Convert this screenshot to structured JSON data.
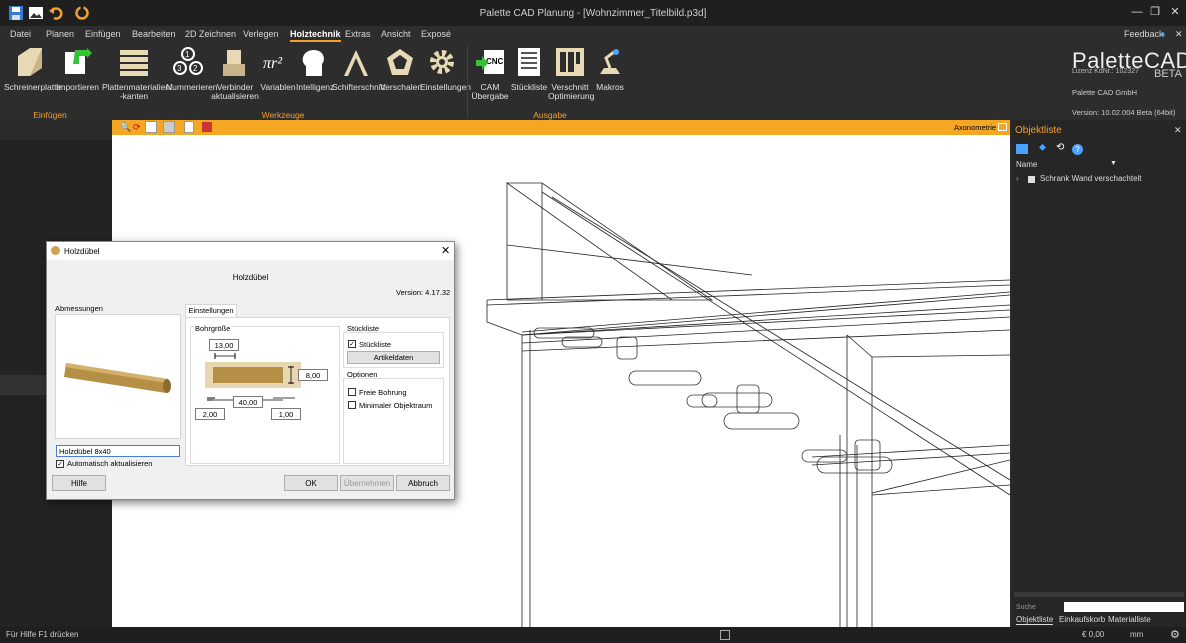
{
  "window": {
    "title": "Palette CAD Planung - [Wohnzimmer_Titelbild.p3d]",
    "feedback": "Feedback"
  },
  "menu_tabs": [
    "Datei",
    "Planen",
    "Einfügen",
    "Bearbeiten",
    "2D Zeichnen",
    "Verlegen",
    "Holztechnik",
    "Extras",
    "Ansicht",
    "Exposé"
  ],
  "active_tab": "Holztechnik",
  "ribbon": {
    "buttons": {
      "schreinerplatte": "Schreinerplatte",
      "importieren": "Importieren",
      "plattenmaterialien_1": "Plattenmaterialien/",
      "plattenmaterialien_2": "-kanten",
      "nummerieren": "Nummerieren",
      "verbinder_1": "Verbinder",
      "verbinder_2": "aktualisieren",
      "variablen": "Variablen",
      "intelligenz": "Intelligenz",
      "schifterschnitt": "Schifterschnitt",
      "verschalen": "Verschalen",
      "einstellungen": "Einstellungen",
      "cam_1": "CAM",
      "cam_2": "Übergabe",
      "stueckliste": "Stückliste",
      "verschnitt_1": "Verschnitt",
      "verschnitt_2": "Optimierung",
      "makros": "Makros"
    },
    "groups": {
      "einfuegen": "Einfügen",
      "werkzeuge": "Werkzeuge",
      "ausgabe": "Ausgabe"
    }
  },
  "brand": {
    "logo_a": "Palette",
    "logo_b": "CAD",
    "license": "Lizenz KdNr.: 102327",
    "beta": "BETA",
    "company": "Palette CAD GmbH",
    "version": "Version: 10.02.004 Beta (64bit)"
  },
  "viewport": {
    "view_label": "Axonometrie"
  },
  "objektliste": {
    "title": "Objektliste",
    "column_name": "Name",
    "item": "Schrank Wand verschachtelt",
    "search_label": "Suche",
    "tabs": [
      "Objektliste",
      "Einkaufskorb",
      "Materialliste"
    ]
  },
  "status": {
    "help": "Für Hilfe F1 drücken",
    "money": "€ 0,00",
    "unit": "mm"
  },
  "dialog": {
    "title": "Holzdübel",
    "heading": "Holzdübel",
    "version": "Version: 4.17.32",
    "abmessungen": "Abmessungen",
    "tab_einstellungen": "Einstellungen",
    "bohrgroesse": "Bohrgröße",
    "dim_top": "13,00",
    "dim_height": "8,00",
    "dim_length": "40,00",
    "dim_left": "2,00",
    "dim_right": "1,00",
    "stueckliste_group": "Stückliste",
    "stueckliste_cb": "Stückliste",
    "artikeldaten": "Artikeldaten",
    "optionen": "Optionen",
    "freie_bohrung": "Freie Bohrung",
    "min_objektraum": "Minimaler Objektraum",
    "name_value": "Holzdübel 8x40",
    "auto_update": "Automatisch aktualisieren",
    "hilfe": "Hilfe",
    "ok": "OK",
    "uebernehmen": "Übernehmen",
    "abbruch": "Abbruch"
  }
}
